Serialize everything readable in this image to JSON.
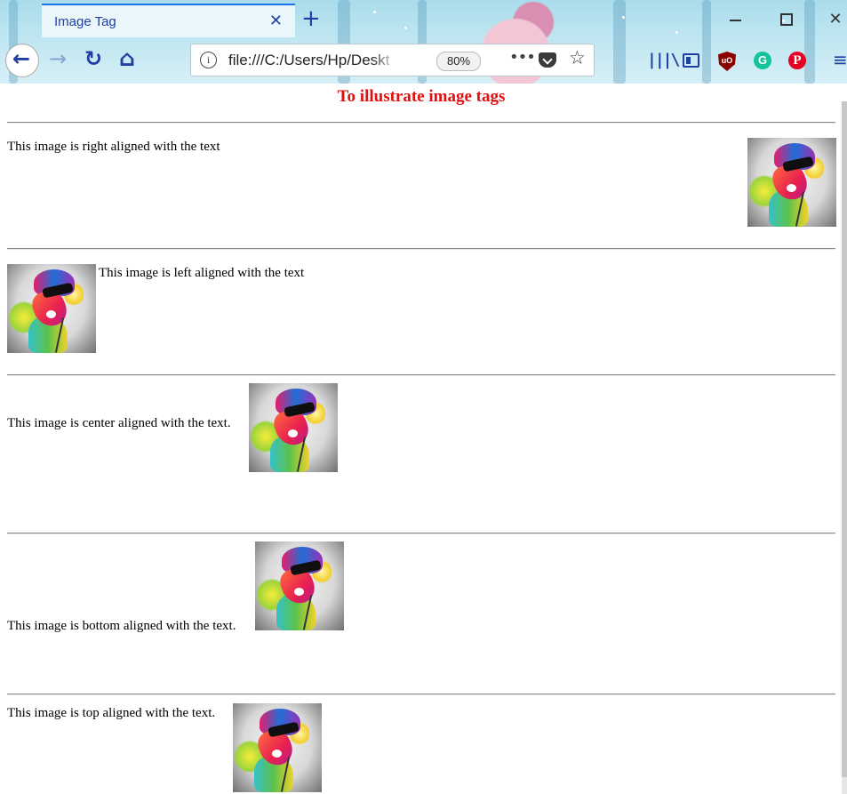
{
  "browser": {
    "tab_title": "Image Tag",
    "tab_close": "✕",
    "new_tab": "+",
    "win_close": "✕",
    "url": "file:///C:/Users/Hp/Deskt",
    "zoom": "80%",
    "icons": {
      "info": "i",
      "more": "•••",
      "star": "☆",
      "library": "|||\\",
      "ublock": "uO",
      "grammarly": "G",
      "pinterest": "P",
      "menu": "≡",
      "back": "←",
      "forward": "→",
      "reload": "↻",
      "home": "⌂"
    }
  },
  "page": {
    "title": "To illustrate image tags",
    "title_color": "#e01010",
    "sections": [
      {
        "caption": "This image is right aligned with the text"
      },
      {
        "caption": "This image is left aligned with the text"
      },
      {
        "caption": "This image is center aligned with the text."
      },
      {
        "caption": "This image is bottom aligned with the text."
      },
      {
        "caption": "This image is top aligned with the text."
      }
    ]
  }
}
